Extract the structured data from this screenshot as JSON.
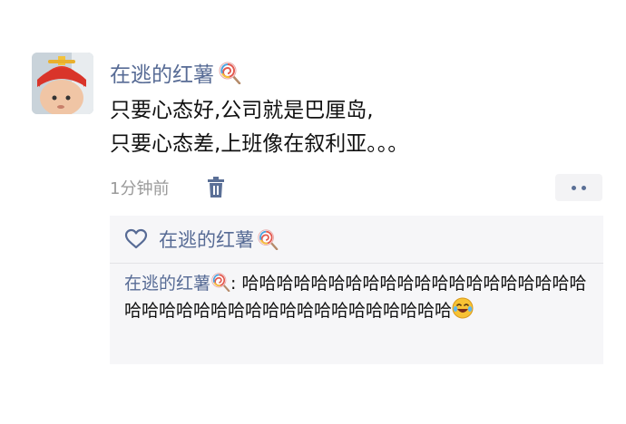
{
  "post": {
    "username": "在逃的红薯",
    "content_lines": [
      "只要心态好,公司就是巴厘岛,",
      "只要心态差,上班像在叙利亚。。。"
    ],
    "time": "1分钟前"
  },
  "likes": {
    "names": [
      "在逃的红薯"
    ]
  },
  "comment": {
    "author": "在逃的红薯",
    "separator": ": ",
    "text": "哈哈哈哈哈哈哈哈哈哈哈哈哈哈哈哈哈哈哈哈哈哈哈哈哈哈哈哈哈哈哈哈哈哈哈哈哈哈哈"
  },
  "icons": {
    "name_badge": "lollipop-icon",
    "emoji": "laughing-crying-emoji-icon",
    "delete": "trash-icon",
    "like": "heart-outline-icon",
    "more": "more-dots-icon"
  },
  "colors": {
    "link": "#576b95",
    "text": "#111111",
    "meta": "#9a9a9a",
    "panel_bg": "#f6f6f8"
  }
}
